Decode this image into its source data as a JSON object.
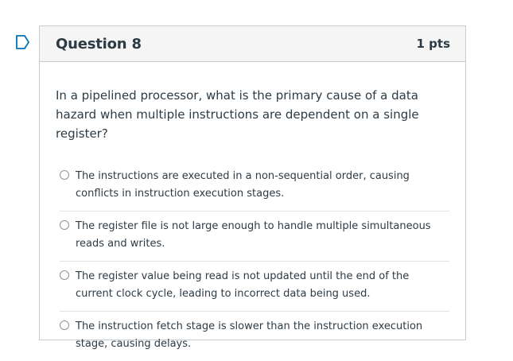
{
  "question": {
    "title": "Question 8",
    "points": "1 pts",
    "text": "In a pipelined processor, what is the primary cause of a data hazard when multiple instructions are dependent on a single register?",
    "answers": [
      {
        "label": "The instructions are executed in a non-sequential order, causing conflicts in instruction execution stages.",
        "selected": false
      },
      {
        "label": "The register file is not large enough to handle multiple simultaneous reads and writes.",
        "selected": false
      },
      {
        "label": "The register value being read is not updated until the end of the current clock cycle, leading to incorrect data being used.",
        "selected": false
      },
      {
        "label": "The instruction fetch stage is slower than the instruction execution stage, causing delays.",
        "selected": false
      }
    ]
  },
  "icons": {
    "flag": "flag-icon"
  },
  "colors": {
    "flag": "#0374b5",
    "text": "#2d3b45",
    "header_bg": "#f5f5f5",
    "border": "#c7cdd1"
  }
}
